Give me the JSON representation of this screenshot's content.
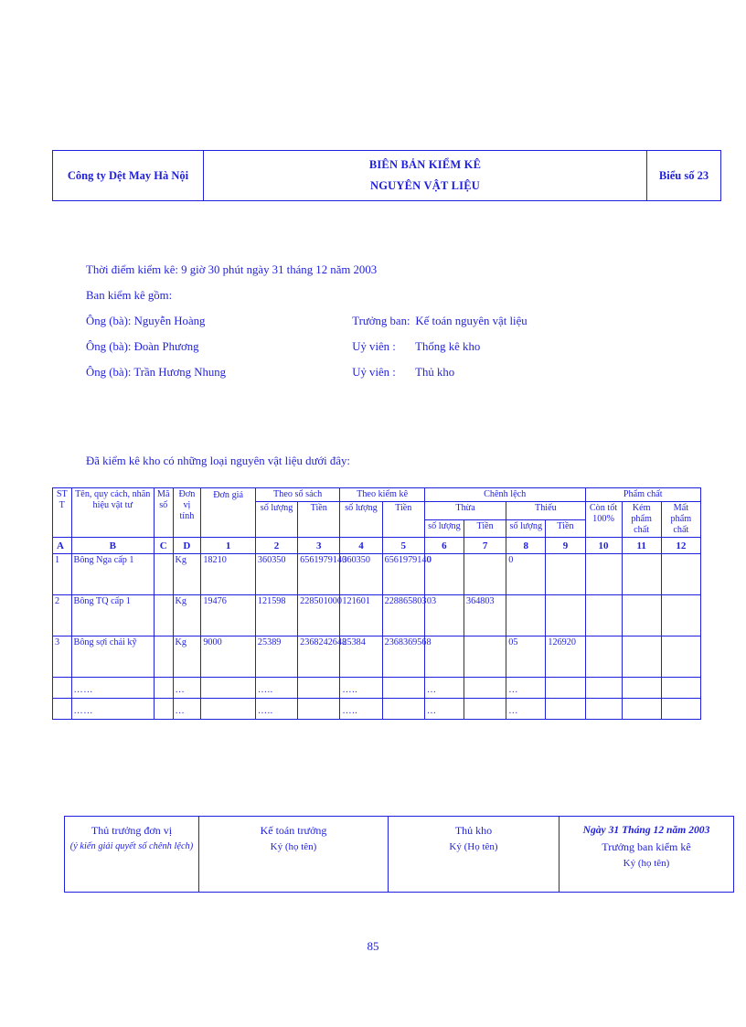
{
  "colors": {
    "text": "#1f1fdd",
    "border": "#1f1fdd",
    "background": "#ffffff"
  },
  "header": {
    "organization": "Công ty Dệt May Hà Nội",
    "title_line_1": "BIÊN BẢN KIỂM KÊ",
    "title_line_2": "NGUYÊN VẬT LIỆU",
    "form_number": "Biểu số 23"
  },
  "intro": {
    "time_line": "Thời điểm kiểm kê: 9 giờ 30 phút ngày 31 tháng 12 năm 2003",
    "committee_line": "Ban kiểm kê gồm:",
    "members": [
      {
        "name": "Ông (bà): Nguyễn Hoàng",
        "role": "Trưởng ban:",
        "role_detail": "Kế toán nguyên vật liệu"
      },
      {
        "name": "Ông (bà): Đoàn Phương",
        "role": "Uỷ viên :",
        "role_detail": "Thống kê kho"
      },
      {
        "name": "Ông (bà): Trần Hương Nhung",
        "role": "Uỷ viên :",
        "role_detail": "Thủ kho"
      }
    ],
    "closing_line": "Đã kiểm kê kho có những loại nguyên vật liệu dưới đây:"
  },
  "table": {
    "headers": {
      "stt": "ST T",
      "name": "Tên, quy cách, nhãn hiệu vật tư",
      "ma_so": "Mã số",
      "don_vi_tinh": "Đơn vị tính",
      "don_gia": "Đơn giá",
      "theo_so_sach": "Theo sổ sách",
      "theo_kiem_ke": "Theo kiểm kê",
      "chenh_lech": "Chênh lệch",
      "pham_chat": "Phẩm chất",
      "so_luong": "số lượng",
      "tien": "Tiền",
      "thua": "Thừa",
      "thieu": "Thiếu",
      "con_tot": "Còn tốt 100%",
      "kem_pham_chat": "Kém phẩm chất",
      "mat_pham_chat": "Mất phẩm chất"
    },
    "code_row": [
      "A",
      "B",
      "C",
      "D",
      "1",
      "2",
      "3",
      "4",
      "5",
      "6",
      "7",
      "8",
      "9",
      "10",
      "11",
      "12"
    ],
    "rows": [
      {
        "stt": "1",
        "name": "Bông Nga cấp 1",
        "ma_so": "",
        "don_vi": "Kg",
        "don_gia": "18210",
        "ss_sl": "360350",
        "ss_tien": "6561979140",
        "kk_sl": "360350",
        "kk_tien": "6561979140",
        "thua_sl": "0",
        "thua_tien": "",
        "thieu_sl": "0",
        "thieu_tien": "",
        "con_tot": "",
        "kem": "",
        "mat": ""
      },
      {
        "stt": "2",
        "name": "Bông TQ cấp 1",
        "ma_so": "",
        "don_vi": "Kg",
        "don_gia": "19476",
        "ss_sl": "121598",
        "ss_tien": "228501000",
        "kk_sl": "121601",
        "kk_tien": "228865803",
        "thua_sl": "03",
        "thua_tien": "364803",
        "thieu_sl": "",
        "thieu_tien": "",
        "con_tot": "",
        "kem": "",
        "mat": ""
      },
      {
        "stt": "3",
        "name": "Bông sợi chải kỹ",
        "ma_so": "",
        "don_vi": "Kg",
        "don_gia": "9000",
        "ss_sl": "25389",
        "ss_tien": "2368242648",
        "kk_sl": "25384",
        "kk_tien": "2368369568",
        "thua_sl": "",
        "thua_tien": "",
        "thieu_sl": "05",
        "thieu_tien": "126920",
        "con_tot": "",
        "kem": "",
        "mat": ""
      },
      {
        "stt": "",
        "name": "……",
        "ma_so": "",
        "don_vi": "…",
        "don_gia": "",
        "ss_sl": "…..",
        "ss_tien": "",
        "kk_sl": "…..",
        "kk_tien": "",
        "thua_sl": "…",
        "thua_tien": "",
        "thieu_sl": "…",
        "thieu_tien": "",
        "con_tot": "",
        "kem": "",
        "mat": ""
      },
      {
        "stt": "",
        "name": "……",
        "ma_so": "",
        "don_vi": "…",
        "don_gia": "",
        "ss_sl": "…..",
        "ss_tien": "",
        "kk_sl": "…..",
        "kk_tien": "",
        "thua_sl": "…",
        "thua_tien": "",
        "thieu_sl": "…",
        "thieu_tien": "",
        "con_tot": "",
        "kem": "",
        "mat": ""
      }
    ]
  },
  "footer": {
    "cells": [
      {
        "title": "Thủ trưởng đơn vị",
        "sub": "(ý kiến giải quyết số chênh lệch)"
      },
      {
        "title": "Kế toán trưởng",
        "sub": "Ký (họ tên)"
      },
      {
        "title": "Thủ kho",
        "sub": "Ký (Họ tên)"
      },
      {
        "date": "Ngày 31 Tháng 12 năm 2003",
        "title": "Trưởng ban kiểm kê",
        "sub": "Ký (họ tên)"
      }
    ]
  },
  "page_number": "85"
}
